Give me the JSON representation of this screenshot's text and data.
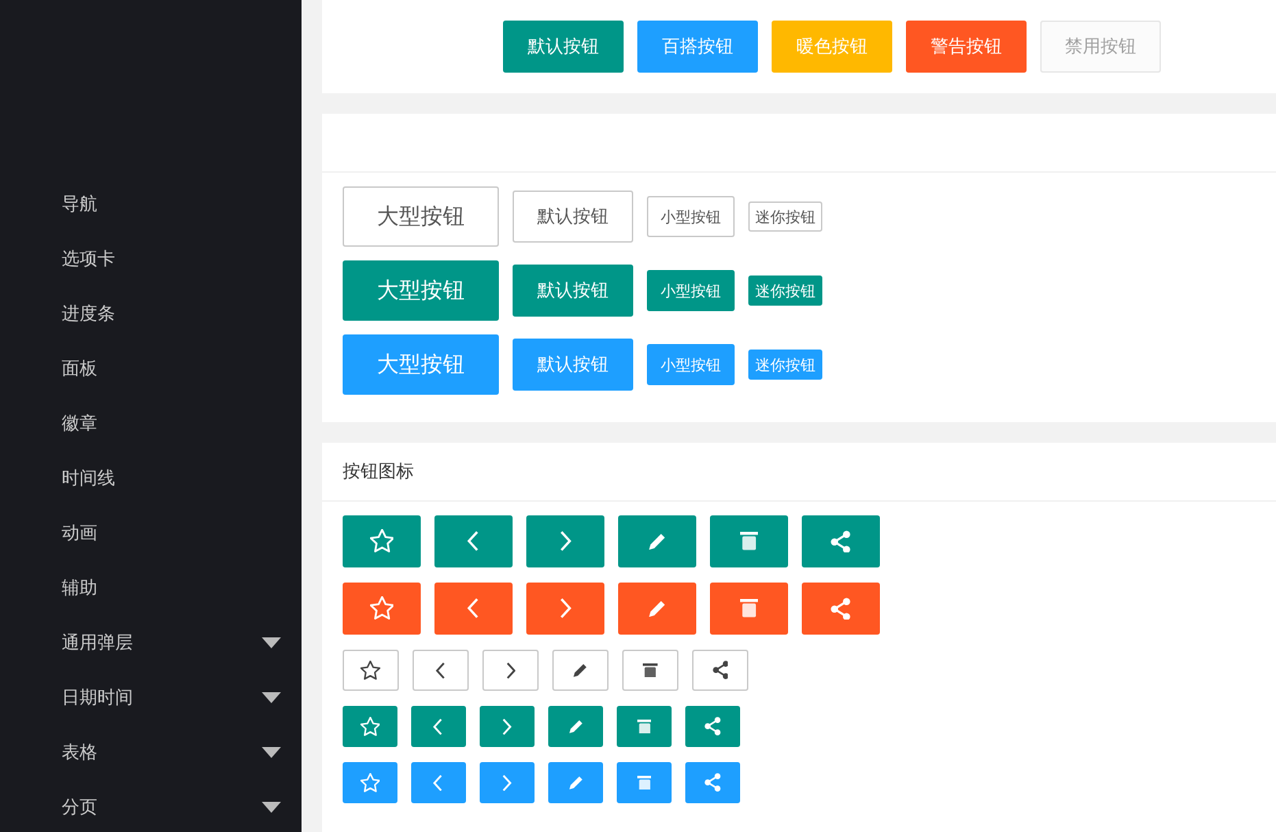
{
  "sidebar": {
    "items": [
      {
        "label": "导航",
        "kind": "link"
      },
      {
        "label": "选项卡",
        "kind": "link"
      },
      {
        "label": "进度条",
        "kind": "link"
      },
      {
        "label": "面板",
        "kind": "link"
      },
      {
        "label": "徽章",
        "kind": "link"
      },
      {
        "label": "时间线",
        "kind": "link"
      },
      {
        "label": "动画",
        "kind": "link"
      },
      {
        "label": "辅助",
        "kind": "link"
      },
      {
        "label": "通用弹层",
        "kind": "group"
      },
      {
        "label": "日期时间",
        "kind": "group"
      },
      {
        "label": "表格",
        "kind": "group"
      },
      {
        "label": "分页",
        "kind": "group"
      }
    ]
  },
  "theme_buttons": [
    {
      "label": "默认按钮",
      "kind": "default"
    },
    {
      "label": "百搭按钮",
      "kind": "normal"
    },
    {
      "label": "暖色按钮",
      "kind": "warm"
    },
    {
      "label": "警告按钮",
      "kind": "danger"
    },
    {
      "label": "禁用按钮",
      "kind": "disabled"
    }
  ],
  "size_rows": [
    {
      "kind": "outline",
      "buttons": [
        {
          "label": "大型按钮",
          "kind": "large"
        },
        {
          "label": "默认按钮",
          "kind": "medium"
        },
        {
          "label": "小型按钮",
          "kind": "small"
        },
        {
          "label": "迷你按钮",
          "kind": "mini"
        }
      ]
    },
    {
      "kind": "default",
      "buttons": [
        {
          "label": "大型按钮",
          "kind": "large"
        },
        {
          "label": "默认按钮",
          "kind": "medium"
        },
        {
          "label": "小型按钮",
          "kind": "small"
        },
        {
          "label": "迷你按钮",
          "kind": "mini"
        }
      ]
    },
    {
      "kind": "normal",
      "buttons": [
        {
          "label": "大型按钮",
          "kind": "large"
        },
        {
          "label": "默认按钮",
          "kind": "medium"
        },
        {
          "label": "小型按钮",
          "kind": "small"
        },
        {
          "label": "迷你按钮",
          "kind": "mini"
        }
      ]
    }
  ],
  "icon_panel": {
    "title": "按钮图标",
    "rows": [
      {
        "kind": "default"
      },
      {
        "kind": "danger"
      },
      {
        "kind": "outline"
      },
      {
        "kind": "compact"
      },
      {
        "kind": "compactblue"
      }
    ]
  }
}
